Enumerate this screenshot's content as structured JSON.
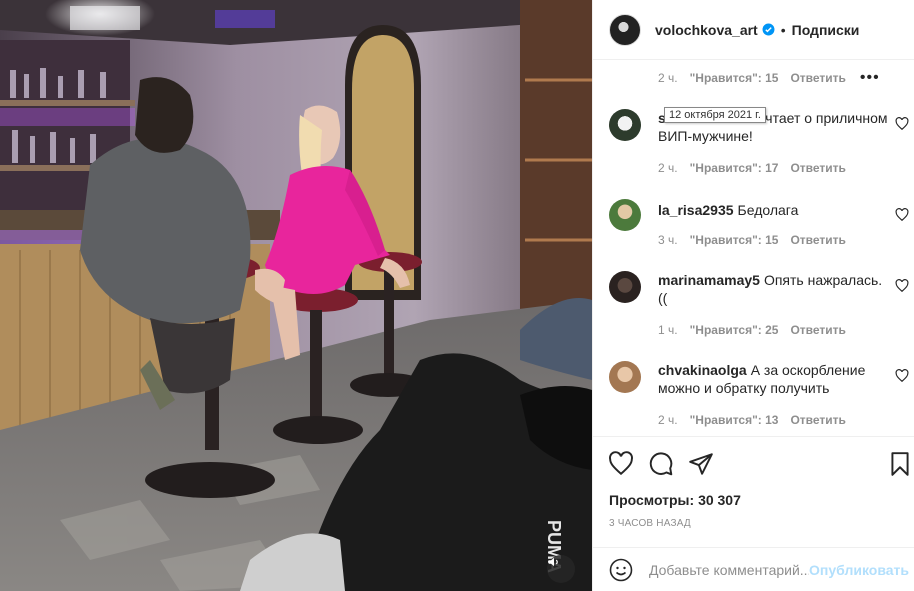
{
  "post": {
    "username": "volochkova_art",
    "separator": "•",
    "follow_label": "Подписки"
  },
  "top_meta": {
    "time": "2 ч.",
    "likes": "\"Нравится\": 15",
    "reply": "Ответить",
    "more": "•••"
  },
  "tooltip": "12 октября 2021 г.",
  "comments": [
    {
      "user": "sh",
      "text": "мечтает о приличном ВИП-мужчине!",
      "time": "2 ч.",
      "likes": "\"Нравится\": 17",
      "reply": "Ответить"
    },
    {
      "user": "la_risa2935",
      "text": "Бедолага",
      "time": "3 ч.",
      "likes": "\"Нравится\": 15",
      "reply": "Ответить"
    },
    {
      "user": "marinamamay5",
      "text": "Опять нажралась. ((",
      "time": "1 ч.",
      "likes": "\"Нравится\": 25",
      "reply": "Ответить"
    },
    {
      "user": "chvakinaolga",
      "text": "А за оскорбление можно и обратку получить",
      "time": "2 ч.",
      "likes": "\"Нравится\": 13",
      "reply": "Ответить"
    }
  ],
  "views": {
    "label": "Просмотры:",
    "value": "30 307"
  },
  "time_ago": "3 ЧАСОВ НАЗАД",
  "add_comment": {
    "placeholder": "Добавьте комментарий...",
    "publish_label": "Опубликовать"
  },
  "colors": {
    "accent_blue": "#0095f6",
    "publish_disabled": "#b2dffc",
    "muted_text": "#8e8e8e",
    "dress_pink": "#e8259c"
  },
  "icons": {
    "sound": "speaker-icon",
    "like": "heart-icon",
    "comment": "comment-bubble-icon",
    "share": "paper-plane-icon",
    "save": "bookmark-icon",
    "emoji": "smiley-icon",
    "verified": "verified-badge-icon"
  }
}
